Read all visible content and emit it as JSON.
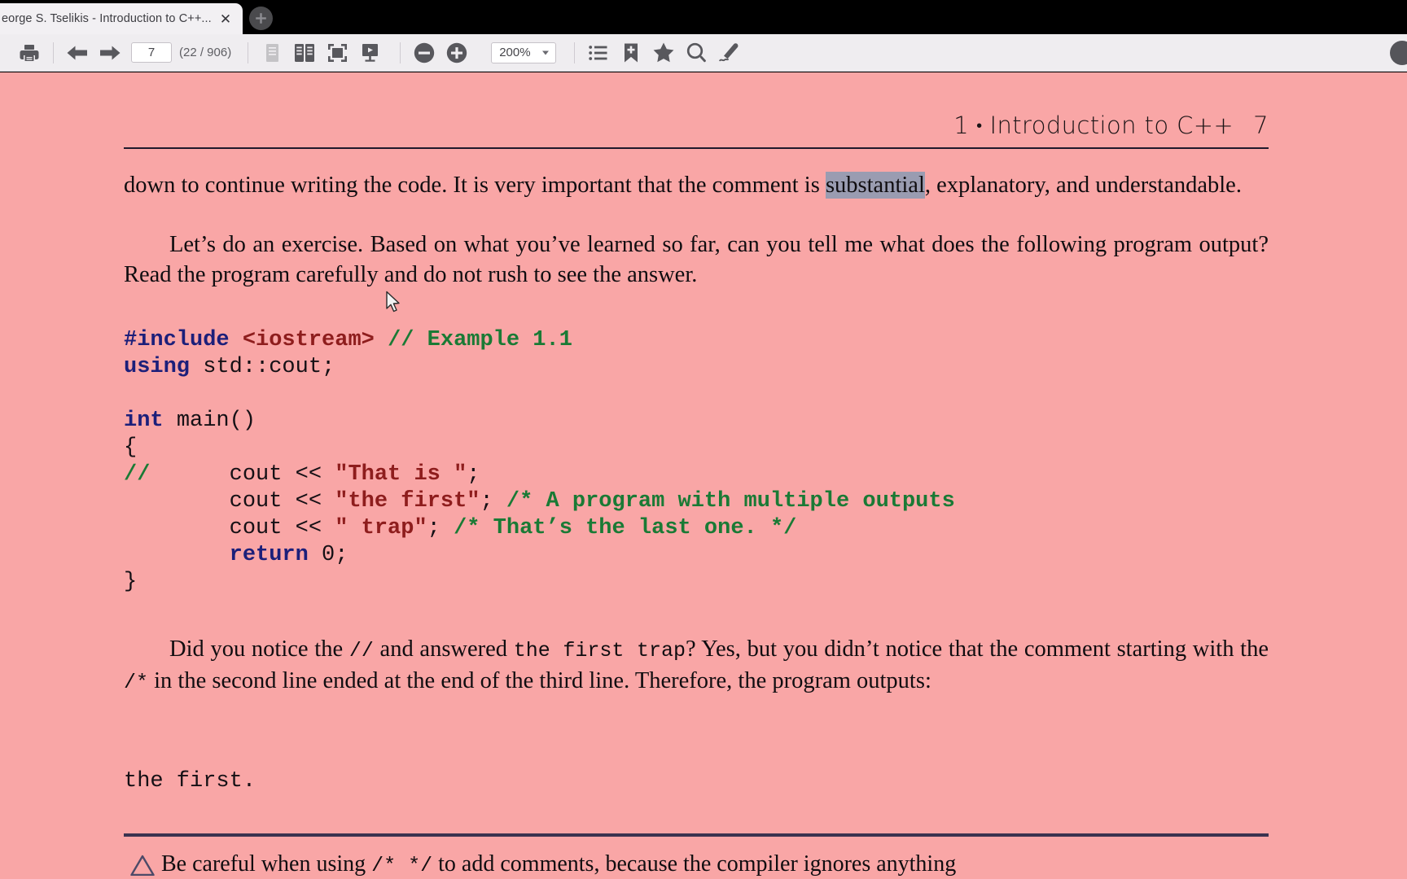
{
  "browser": {
    "tab": {
      "title": "eorge S. Tselikis - Introduction to C++...",
      "close_label": "✕"
    },
    "new_tab_label": "+"
  },
  "toolbar": {
    "print_tooltip": "Print",
    "prev_tooltip": "Previous Page",
    "next_tooltip": "Next Page",
    "page_number": "7",
    "page_count": "(22 / 906)",
    "single_page_tooltip": "Single Page View",
    "dual_page_tooltip": "Dual Page View",
    "fit_page_tooltip": "Fit Page",
    "presentation_tooltip": "Presentation Mode",
    "zoom_out_label": "−",
    "zoom_in_label": "+",
    "zoom_value": "200%",
    "outline_tooltip": "Table of Contents",
    "bookmark_tooltip": "Add Bookmark",
    "favorites_tooltip": "Favorites",
    "search_tooltip": "Find",
    "annotate_tooltip": "Annotate"
  },
  "document": {
    "running_head": {
      "chapter": "1",
      "separator": "•",
      "title": "Introduction to C++",
      "page": "7"
    },
    "paragraph_1": {
      "before": "down to continue writing the code. It is very important that the comment is ",
      "selected": "substantial",
      "after": ", explanatory, and understandable."
    },
    "paragraph_2": "Let’s do an exercise. Based on what you’ve learned so far, can you tell me what does the following program output? Read the program carefully and do not rush to see the answer.",
    "code": {
      "line_1_kw": "#include",
      "line_1_hdr": "<iostream>",
      "line_1_cmt": "// Example 1.1",
      "line_2_kw": "using",
      "line_2_pln": "std::cout;",
      "line_4_kw": "int",
      "line_4_pln": "main()",
      "line_5_pln": "{",
      "line_6_cmt": "//",
      "line_6_pln_a": "cout << ",
      "line_6_str": "\"That is \"",
      "line_6_pln_b": ";",
      "line_7_pln_a": "cout << ",
      "line_7_str": "\"the first\"",
      "line_7_pln_b": "; ",
      "line_7_cmt": "/* A program with multiple outputs",
      "line_8_pln_a": "cout << ",
      "line_8_str": "\" trap\"",
      "line_8_pln_b": "; ",
      "line_8_cmt": "/* That’s the last one. */",
      "line_9_kw": "return",
      "line_9_pln": " 0;",
      "line_10_pln": "}"
    },
    "paragraph_3": {
      "a": "Did you notice the ",
      "m1": "//",
      "b": " and answered ",
      "m2": "the first trap",
      "c": "? Yes, but you didn’t notice that the comment starting with the ",
      "m3": "/*",
      "d": " in the second line ended at the end of the third line. Therefore, the program outputs:"
    },
    "output_line": "the first.",
    "warning": {
      "a": "Be careful when using ",
      "m1": "/* */",
      "b": " to add comments, because the compiler ignores anything"
    }
  },
  "colors": {
    "page_background": "#f9a6a6",
    "toolbar_background": "#efedf0",
    "selection": "#9a9cb1",
    "keyword": "#1c1f7a",
    "string": "#8e1d1d",
    "comment": "#1a7a35",
    "rule": "#201a2c"
  }
}
